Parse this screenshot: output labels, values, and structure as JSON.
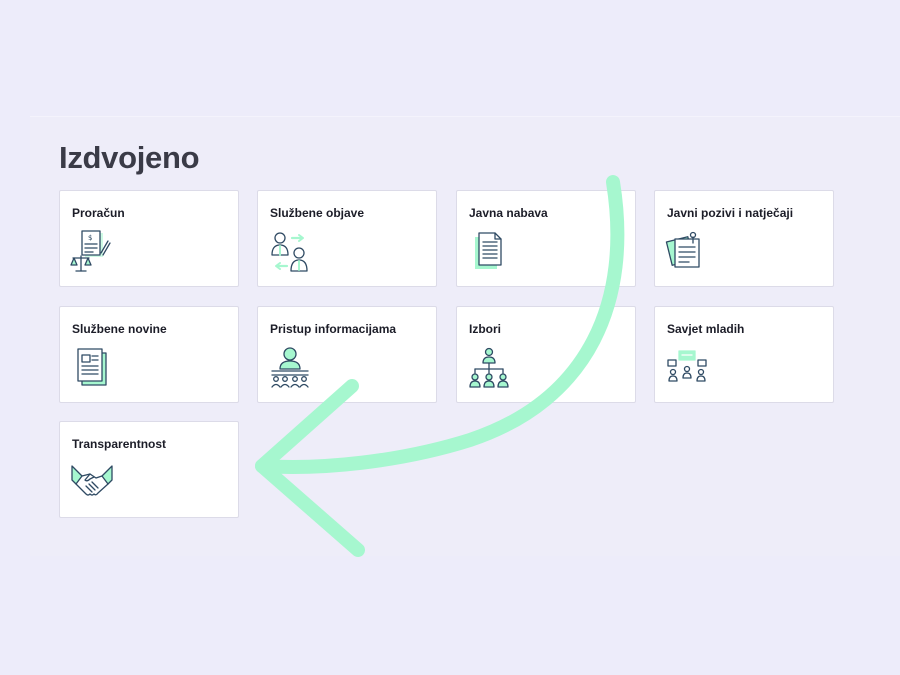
{
  "section": {
    "title": "Izdvojeno"
  },
  "cards": [
    {
      "title": "Proračun",
      "icon": "budget-scales-icon"
    },
    {
      "title": "Službene objave",
      "icon": "people-exchange-icon"
    },
    {
      "title": "Javna nabava",
      "icon": "documents-icon"
    },
    {
      "title": "Javni pozivi i natječaji",
      "icon": "pinned-notes-icon"
    },
    {
      "title": "Službene novine",
      "icon": "newspaper-icon"
    },
    {
      "title": "Pristup informacijama",
      "icon": "speaker-podium-icon"
    },
    {
      "title": "Izbori",
      "icon": "hierarchy-icon"
    },
    {
      "title": "Savjet mladih",
      "icon": "group-discussion-icon"
    },
    {
      "title": "Transparentnost",
      "icon": "handshake-icon"
    }
  ],
  "colors": {
    "accent": "#a6f7cf",
    "icon_stroke": "#2f4a63",
    "title": "#3a3b47"
  }
}
